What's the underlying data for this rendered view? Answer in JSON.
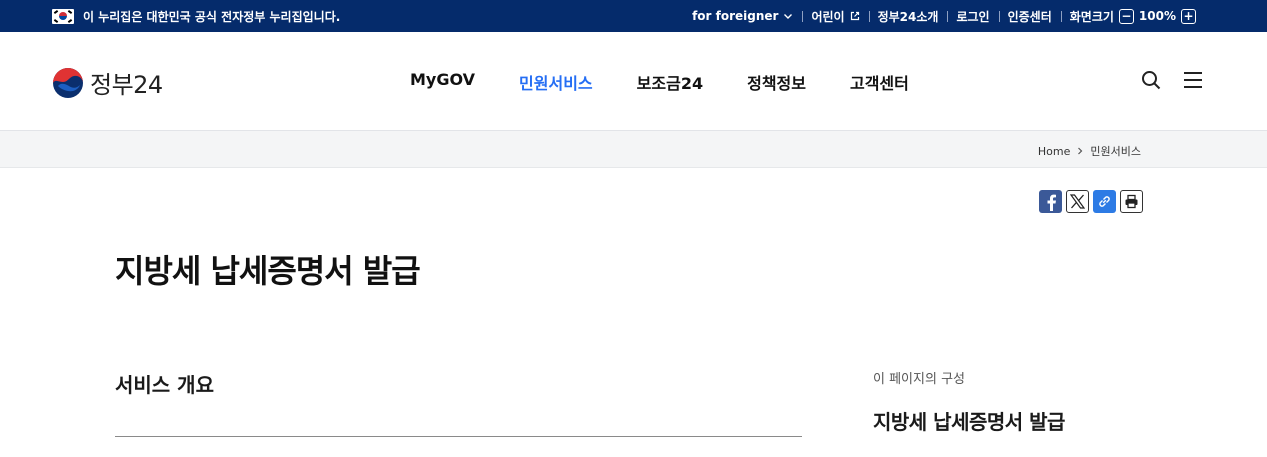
{
  "gov_bar": {
    "notice": "이 누리집은 대한민국 공식 전자정부 누리집입니다.",
    "foreigner": "for foreigner",
    "kids": "어린이",
    "about": "정부24소개",
    "login": "로그인",
    "cert": "인증센터",
    "zoom_label": "화면크기",
    "zoom_value": "100%",
    "zoom_minus": "−",
    "zoom_plus": "+"
  },
  "header": {
    "logo_text": "정부24",
    "nav": [
      "MyGOV",
      "민원서비스",
      "보조금24",
      "정책정보",
      "고객센터"
    ],
    "active_nav": "민원서비스"
  },
  "breadcrumb": [
    "Home",
    "민원서비스"
  ],
  "page": {
    "title": "지방세 납세증명서 발급",
    "section_title": "서비스 개요",
    "toc_label": "이 페이지의 구성",
    "toc_item": "지방세 납세증명서 발급"
  },
  "colors": {
    "gov_bar": "#052b6b",
    "accent": "#256ef4",
    "facebook": "#3b5998",
    "link": "#2d7be5"
  }
}
